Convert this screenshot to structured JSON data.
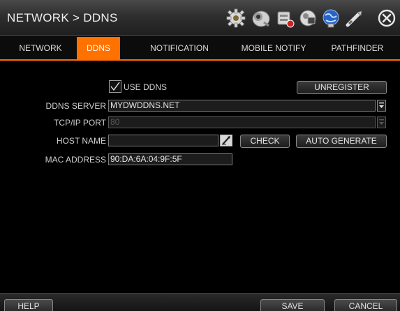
{
  "window": {
    "title": "NETWORK > DDNS",
    "icons": [
      "gear-icon",
      "camera-icon",
      "storage-icon",
      "schedule-icon",
      "network-globe-icon",
      "tools-icon",
      "close-icon"
    ]
  },
  "tabs": [
    {
      "label": "NETWORK",
      "active": false
    },
    {
      "label": "DDNS",
      "active": true
    },
    {
      "label": "NOTIFICATION",
      "active": false
    },
    {
      "label": "MOBILE NOTIFY",
      "active": false
    },
    {
      "label": "PATHFINDER",
      "active": false
    }
  ],
  "form": {
    "use_ddns": {
      "label": "USE DDNS",
      "checked": true
    },
    "unregister_label": "UNREGISTER",
    "ddns_server": {
      "label": "DDNS SERVER",
      "value": "MYDWDDNS.NET"
    },
    "tcp_ip_port": {
      "label": "TCP/IP PORT",
      "value": "80",
      "enabled": false
    },
    "host_name": {
      "label": "HOST NAME",
      "value": ""
    },
    "check_label": "CHECK",
    "auto_generate_label": "AUTO GENERATE",
    "mac_address": {
      "label": "MAC ADDRESS",
      "value": "90:DA:6A:04:9F:5F"
    }
  },
  "footer": {
    "help_label": "HELP",
    "save_label": "SAVE",
    "cancel_label": "CANCEL"
  },
  "colors": {
    "accent": "#ff7200",
    "background": "#000000"
  }
}
